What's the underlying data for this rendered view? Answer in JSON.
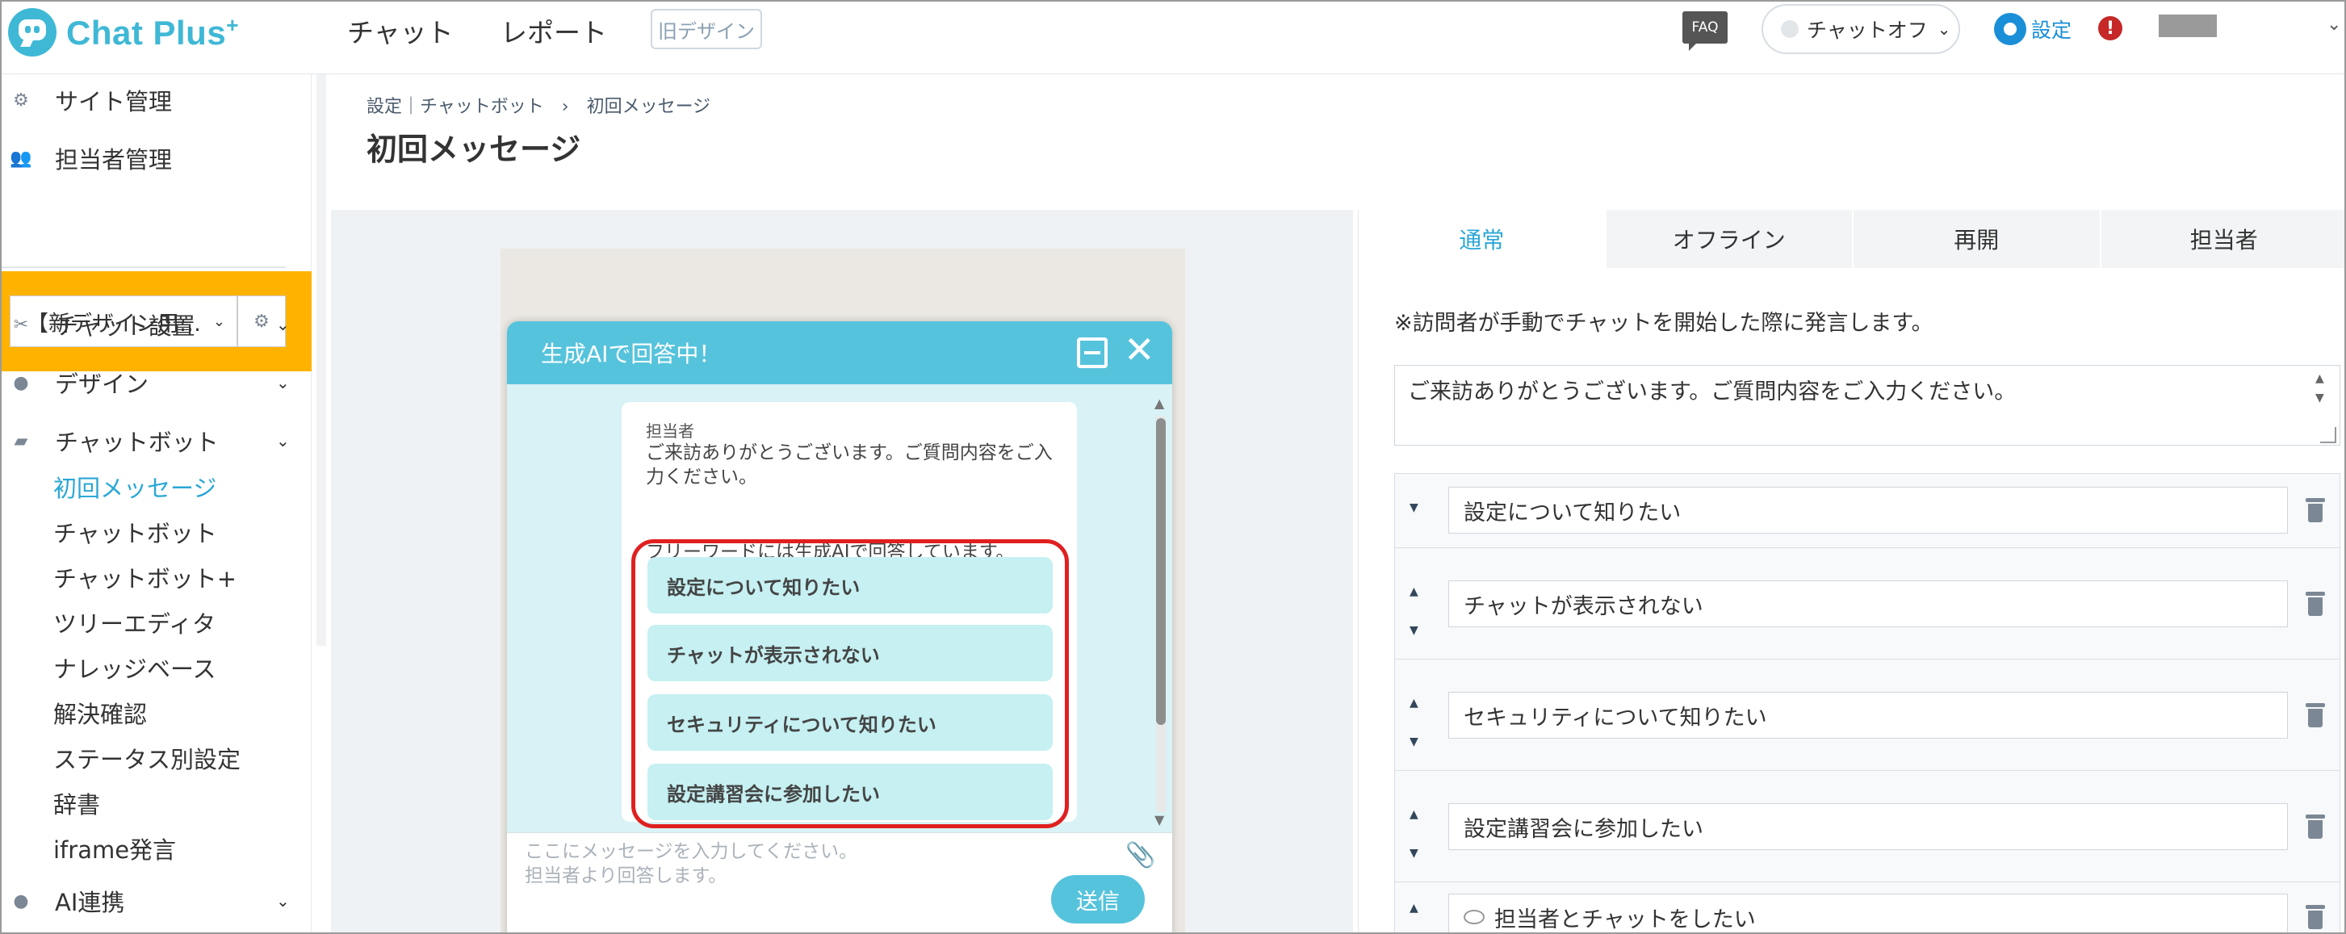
{
  "topbar": {
    "logo_text": "Chat Plus",
    "logo_sup": "+",
    "nav": [
      "チャット",
      "レポート"
    ],
    "old_design": "旧デザイン",
    "faq": "FAQ",
    "chat_status": "チャットオフ",
    "settings": "設定",
    "alert": "!"
  },
  "sidebar": {
    "site_manage": "サイト管理",
    "staff_manage": "担当者管理",
    "site_select": "【新デザイン用…",
    "chat_settings": "チャット設置",
    "design": "デザイン",
    "chatbot": "チャットボット",
    "sub_items": [
      "初回メッセージ",
      "チャットボット",
      "チャットボット+",
      "ツリーエディタ",
      "ナレッジベース",
      "解決確認",
      "ステータス別設定",
      "辞書",
      "iframe発言"
    ],
    "ai": "AI連携"
  },
  "main": {
    "breadcrumb": "設定｜チャットボット　›　初回メッセージ",
    "title": "初回メッセージ"
  },
  "widget": {
    "header": "生成AIで回答中！",
    "sender": "担当者",
    "greeting": "ご来訪ありがとうございます。ご質問内容をご入力ください。",
    "note": "フリーワードには生成AIで回答しています。",
    "choices": [
      "設定について知りたい",
      "チャットが表示されない",
      "セキュリティについて知りたい",
      "設定講習会に参加したい"
    ],
    "input_placeholder_1": "ここにメッセージを入力してください。",
    "input_placeholder_2": "担当者より回答します。",
    "send": "送信"
  },
  "panel": {
    "tabs": [
      "通常",
      "オフライン",
      "再開",
      "担当者"
    ],
    "note": "※訪問者が手動でチャットを開始した際に発言します。",
    "message": "ご来訪ありがとうございます。ご質問内容をご入力ください。",
    "choices": [
      "設定について知りたい",
      "チャットが表示されない",
      "セキュリティについて知りたい",
      "設定講習会に参加したい",
      "担当者とチャットをしたい"
    ]
  },
  "colors": {
    "brand": "#3fb8d6",
    "widget_header": "#56c3dc",
    "highlight_red": "#e02020",
    "site_select_bg": "#ffb300",
    "active_link": "#2aa7d6"
  }
}
